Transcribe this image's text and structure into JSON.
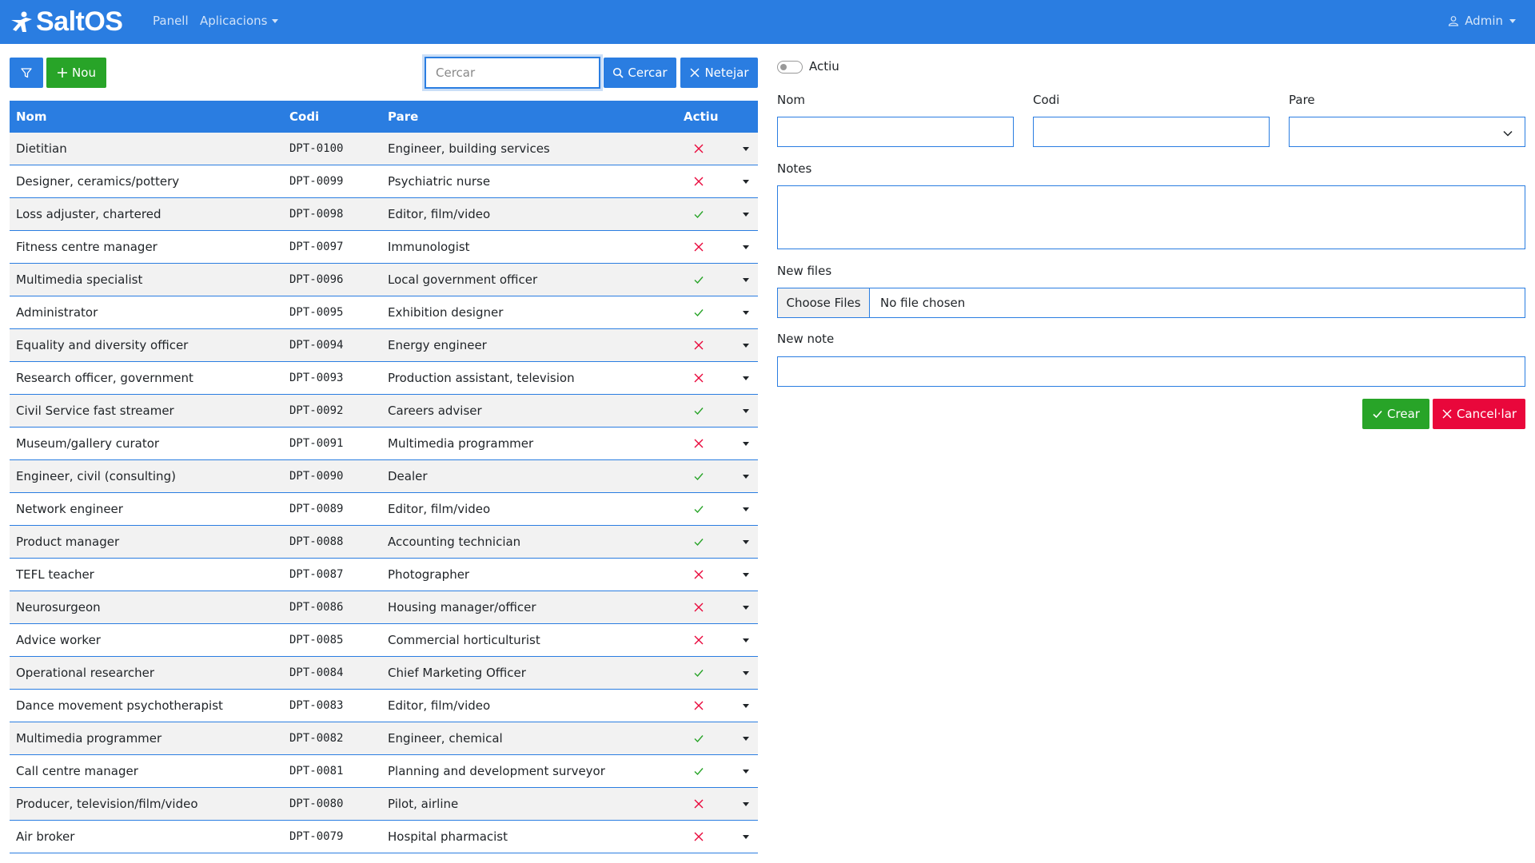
{
  "navbar": {
    "brand": "SaltOS",
    "links": [
      "Panell",
      "Aplicacions"
    ],
    "user": "Admin"
  },
  "toolbar": {
    "filter_icon": "filter-icon",
    "new_label": "Nou",
    "search_placeholder": "Cercar",
    "search_value": "",
    "search_label": "Cercar",
    "clear_label": "Netejar"
  },
  "table": {
    "headers": [
      "Nom",
      "Codi",
      "Pare",
      "Actiu"
    ],
    "rows": [
      {
        "name": "Dietitian",
        "code": "DPT-0100",
        "parent": "Engineer, building services",
        "active": false
      },
      {
        "name": "Designer, ceramics/pottery",
        "code": "DPT-0099",
        "parent": "Psychiatric nurse",
        "active": false
      },
      {
        "name": "Loss adjuster, chartered",
        "code": "DPT-0098",
        "parent": "Editor, film/video",
        "active": true
      },
      {
        "name": "Fitness centre manager",
        "code": "DPT-0097",
        "parent": "Immunologist",
        "active": false
      },
      {
        "name": "Multimedia specialist",
        "code": "DPT-0096",
        "parent": "Local government officer",
        "active": true
      },
      {
        "name": "Administrator",
        "code": "DPT-0095",
        "parent": "Exhibition designer",
        "active": true
      },
      {
        "name": "Equality and diversity officer",
        "code": "DPT-0094",
        "parent": "Energy engineer",
        "active": false
      },
      {
        "name": "Research officer, government",
        "code": "DPT-0093",
        "parent": "Production assistant, television",
        "active": false
      },
      {
        "name": "Civil Service fast streamer",
        "code": "DPT-0092",
        "parent": "Careers adviser",
        "active": true
      },
      {
        "name": "Museum/gallery curator",
        "code": "DPT-0091",
        "parent": "Multimedia programmer",
        "active": false
      },
      {
        "name": "Engineer, civil (consulting)",
        "code": "DPT-0090",
        "parent": "Dealer",
        "active": true
      },
      {
        "name": "Network engineer",
        "code": "DPT-0089",
        "parent": "Editor, film/video",
        "active": true
      },
      {
        "name": "Product manager",
        "code": "DPT-0088",
        "parent": "Accounting technician",
        "active": true
      },
      {
        "name": "TEFL teacher",
        "code": "DPT-0087",
        "parent": "Photographer",
        "active": false
      },
      {
        "name": "Neurosurgeon",
        "code": "DPT-0086",
        "parent": "Housing manager/officer",
        "active": false
      },
      {
        "name": "Advice worker",
        "code": "DPT-0085",
        "parent": "Commercial horticulturist",
        "active": false
      },
      {
        "name": "Operational researcher",
        "code": "DPT-0084",
        "parent": "Chief Marketing Officer",
        "active": true
      },
      {
        "name": "Dance movement psychotherapist",
        "code": "DPT-0083",
        "parent": "Editor, film/video",
        "active": false
      },
      {
        "name": "Multimedia programmer",
        "code": "DPT-0082",
        "parent": "Engineer, chemical",
        "active": true
      },
      {
        "name": "Call centre manager",
        "code": "DPT-0081",
        "parent": "Planning and development surveyor",
        "active": true
      },
      {
        "name": "Producer, television/film/video",
        "code": "DPT-0080",
        "parent": "Pilot, airline",
        "active": false
      },
      {
        "name": "Air broker",
        "code": "DPT-0079",
        "parent": "Hospital pharmacist",
        "active": false
      }
    ]
  },
  "form": {
    "active_label": "Actiu",
    "name_label": "Nom",
    "code_label": "Codi",
    "parent_label": "Pare",
    "notes_label": "Notes",
    "files_label": "New files",
    "choose_files": "Choose Files",
    "no_file": "No file chosen",
    "new_note_label": "New note",
    "create_label": "Crear",
    "cancel_label": "Cancel·lar"
  },
  "colors": {
    "primary": "#2a7de1",
    "success": "#28a428",
    "danger": "#e9073b",
    "check": "#28a428",
    "cross": "#e9073b"
  }
}
